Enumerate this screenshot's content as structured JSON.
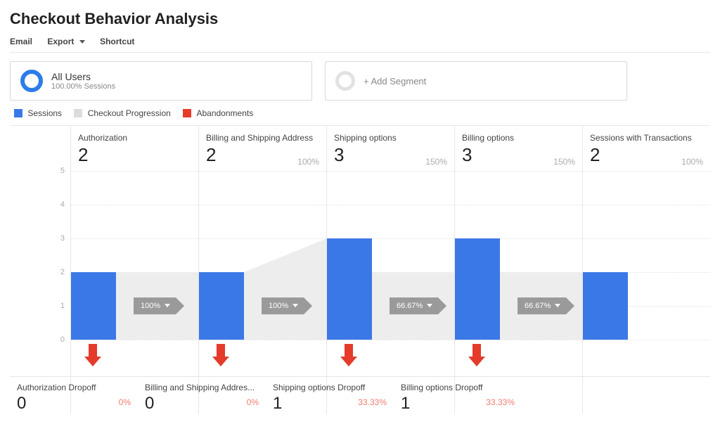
{
  "title": "Checkout Behavior Analysis",
  "toolbar": {
    "email": "Email",
    "export": "Export",
    "shortcut": "Shortcut"
  },
  "segment": {
    "name": "All Users",
    "sub": "100.00% Sessions",
    "add_label": "+ Add Segment"
  },
  "legend": {
    "sessions": "Sessions",
    "progression": "Checkout Progression",
    "abandonments": "Abandonments"
  },
  "colors": {
    "sessions": "#3b78e7",
    "progression": "#ededed",
    "abandon": "#e43b2a"
  },
  "yaxis": {
    "min": 0,
    "max": 5,
    "ticks": [
      0,
      1,
      2,
      3,
      4,
      5
    ]
  },
  "columns": [
    {
      "name": "Authorization",
      "value": 2,
      "pct": "",
      "progression_pct": "100%",
      "prog_from": 2,
      "prog_to": 2,
      "drop_name": "Authorization Dropoff",
      "drop_value": 0,
      "drop_pct": "0%"
    },
    {
      "name": "Billing and Shipping Address",
      "value": 2,
      "pct": "100%",
      "progression_pct": "100%",
      "prog_from": 2,
      "prog_to": 3,
      "drop_name": "Billing and Shipping Addres...",
      "drop_value": 0,
      "drop_pct": "0%"
    },
    {
      "name": "Shipping options",
      "value": 3,
      "pct": "150%",
      "progression_pct": "66.67%",
      "prog_from": 2,
      "prog_to": 2,
      "drop_name": "Shipping options Dropoff",
      "drop_value": 1,
      "drop_pct": "33.33%"
    },
    {
      "name": "Billing options",
      "value": 3,
      "pct": "150%",
      "progression_pct": "66.67%",
      "prog_from": 2,
      "prog_to": 2,
      "drop_name": "Billing options Dropoff",
      "drop_value": 1,
      "drop_pct": "33.33%"
    },
    {
      "name": "Sessions with Transactions",
      "value": 2,
      "pct": "100%",
      "progression_pct": "",
      "prog_from": 0,
      "prog_to": 0,
      "drop_name": "",
      "drop_value": "",
      "drop_pct": ""
    }
  ],
  "chart_data": {
    "type": "bar",
    "title": "Checkout Behavior Analysis",
    "ylabel": "Sessions",
    "ylim": [
      0,
      5
    ],
    "categories": [
      "Authorization",
      "Billing and Shipping Address",
      "Shipping options",
      "Billing options",
      "Sessions with Transactions"
    ],
    "series": [
      {
        "name": "Sessions",
        "values": [
          2,
          2,
          3,
          3,
          2
        ]
      },
      {
        "name": "Checkout Progression (%)",
        "values": [
          100,
          100,
          66.67,
          66.67,
          null
        ]
      },
      {
        "name": "Abandonments",
        "values": [
          0,
          0,
          1,
          1,
          null
        ]
      },
      {
        "name": "Abandonment Rate (%)",
        "values": [
          0,
          0,
          33.33,
          33.33,
          null
        ]
      }
    ]
  }
}
